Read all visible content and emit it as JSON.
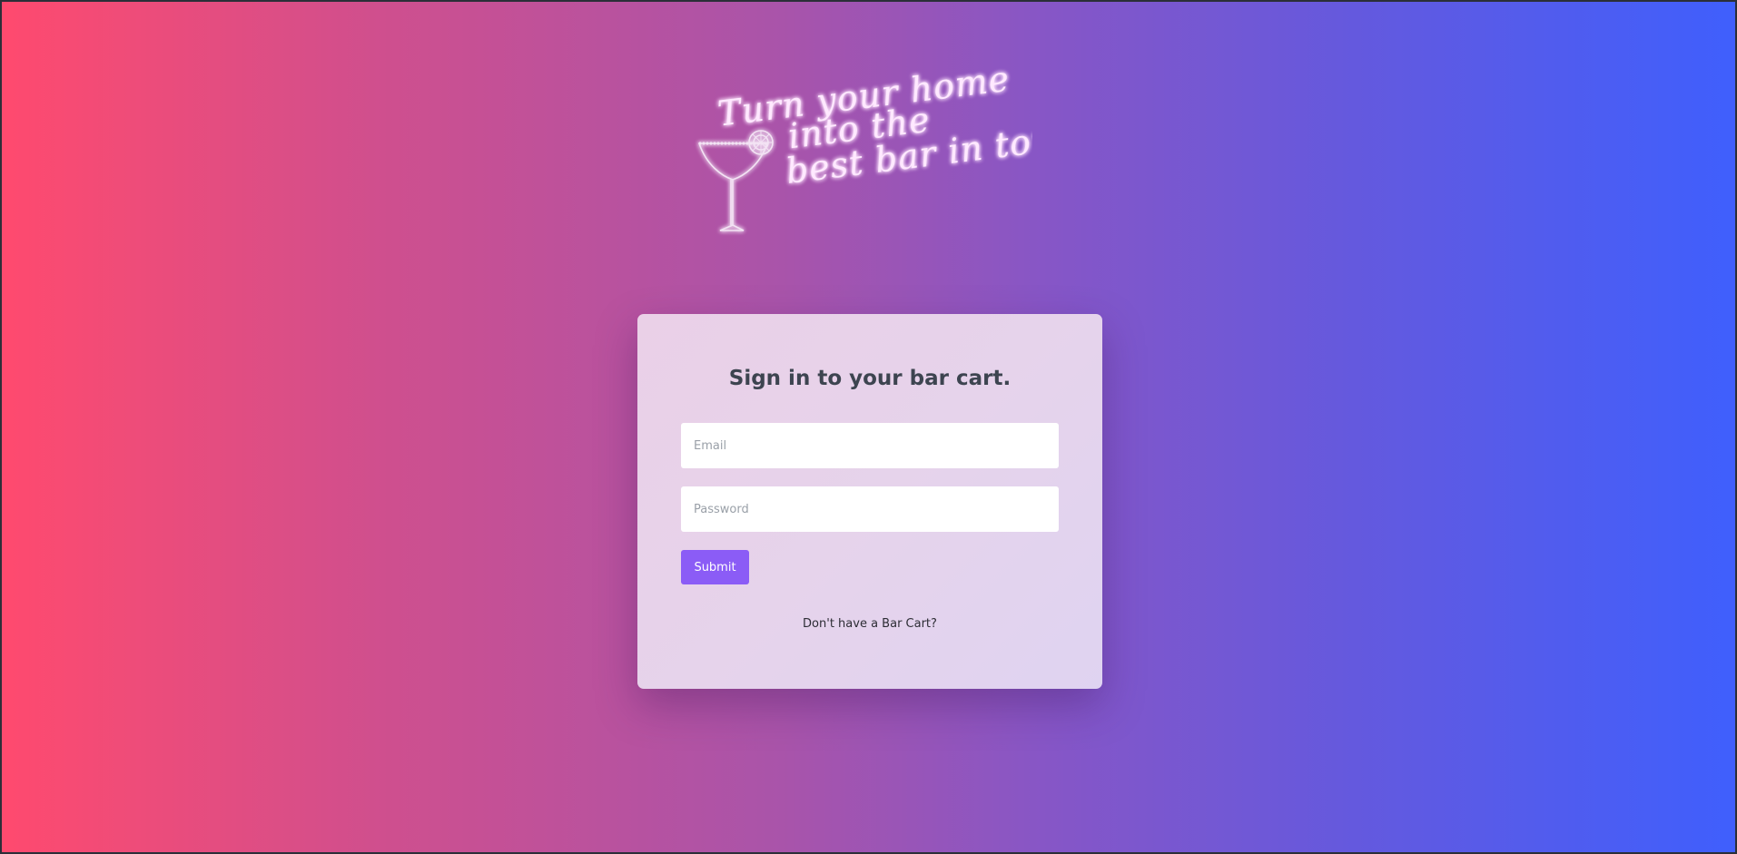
{
  "hero": {
    "tagline_line1": "Turn your home",
    "tagline_line2": "into the",
    "tagline_line3": "best bar in town.",
    "illustration_icon": "margarita-glass-icon"
  },
  "login": {
    "title": "Sign in to your bar cart.",
    "email_placeholder": "Email",
    "password_placeholder": "Password",
    "submit_label": "Submit",
    "signup_link": "Don't have a Bar Cart?"
  },
  "colors": {
    "gradient_left": "#ff4a6e",
    "gradient_right": "#3f5ffd",
    "button": "#8b5cf6",
    "card_background": "#e6d3eb",
    "title_text": "#3d4450",
    "neon_text": "#ffe9ff"
  }
}
